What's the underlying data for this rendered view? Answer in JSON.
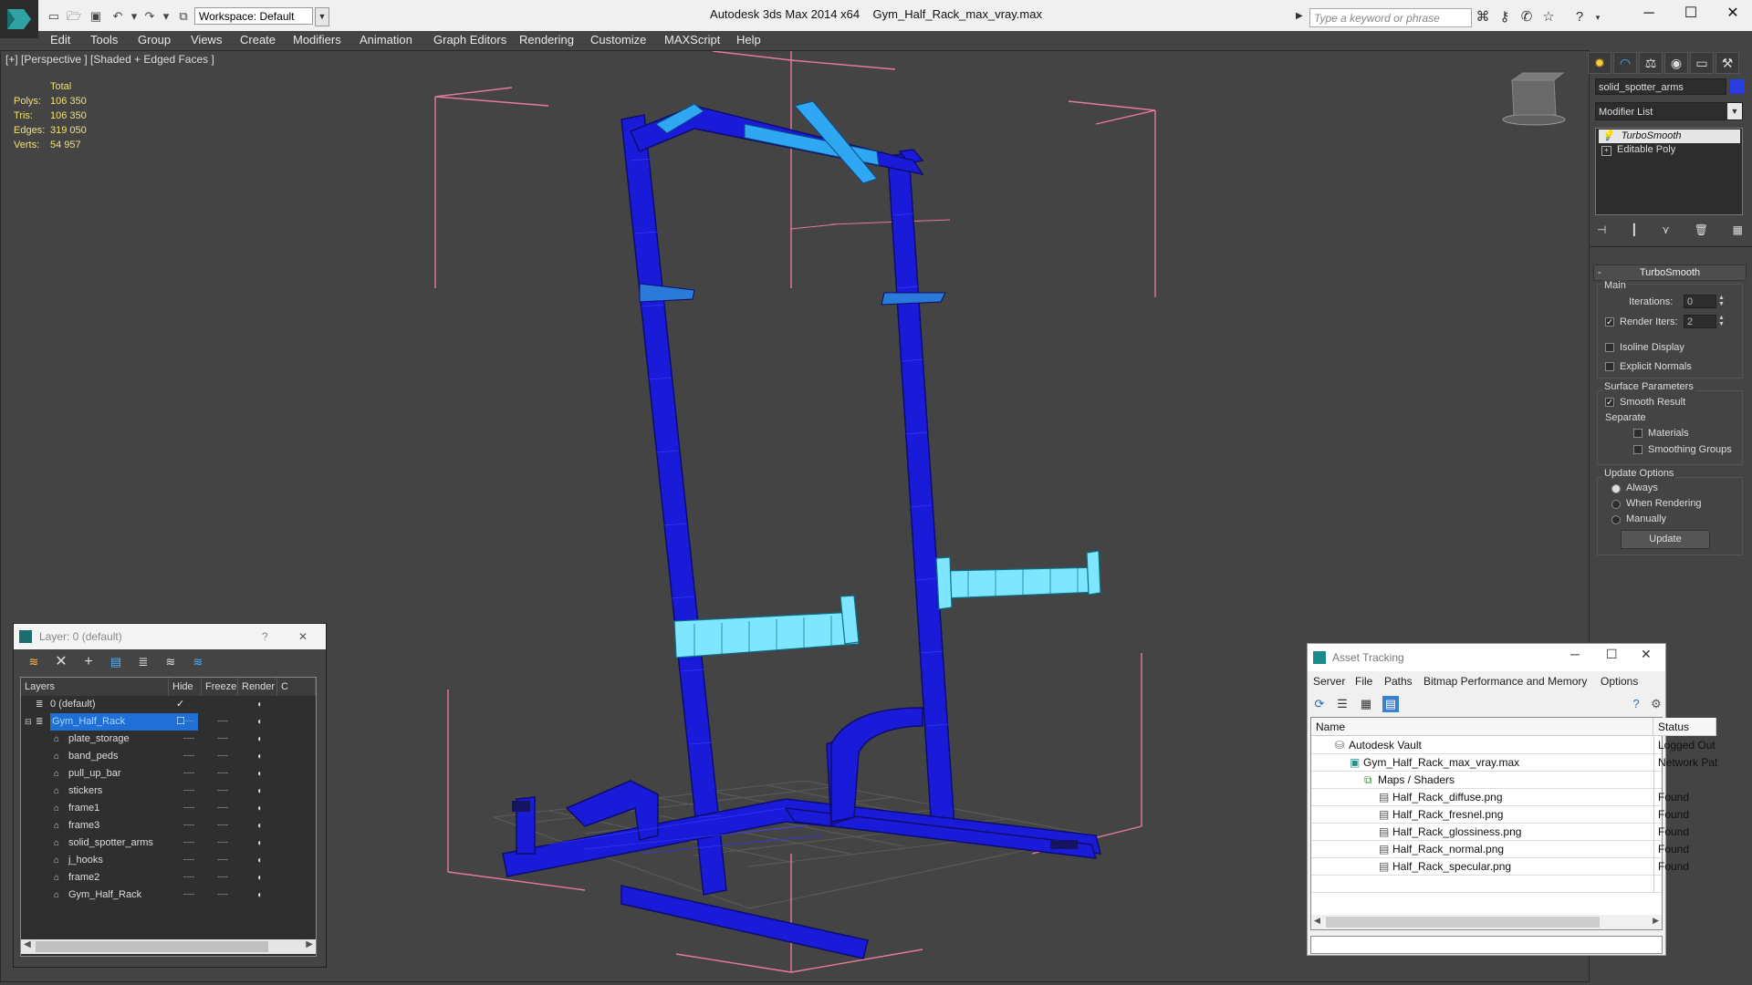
{
  "titlebar": {
    "workspace": "Workspace: Default",
    "app_title": "Autodesk 3ds Max  2014 x64",
    "file_name": "Gym_Half_Rack_max_vray.max",
    "search_placeholder": "Type a keyword or phrase"
  },
  "menu": [
    "Edit",
    "Tools",
    "Group",
    "Views",
    "Create",
    "Modifiers",
    "Animation",
    "Graph Editors",
    "Rendering",
    "Customize",
    "MAXScript",
    "Help"
  ],
  "viewport": {
    "label": "[+] [Perspective ] [Shaded + Edged Faces ]",
    "stats_header": "Total",
    "stats": [
      {
        "label": "Polys:",
        "value": "106 350"
      },
      {
        "label": "Tris:",
        "value": "106 350"
      },
      {
        "label": "Edges:",
        "value": "319 050"
      },
      {
        "label": "Verts:",
        "value": "54 957"
      }
    ],
    "wire_color": "#1a1ad9",
    "selected_color": "#5fd7ff",
    "bbox_color": "#e87a9a"
  },
  "command_panel": {
    "object_name": "solid_spotter_arms",
    "object_color": "#2a3bdf",
    "modifier_list": "Modifier List",
    "stack": [
      "TurboSmooth",
      "Editable Poly"
    ],
    "rollout_title": "TurboSmooth",
    "main_label": "Main",
    "iterations_label": "Iterations:",
    "iterations_value": "0",
    "render_iters_label": "Render Iters:",
    "render_iters_value": "2",
    "isoline_label": "Isoline Display",
    "explicit_label": "Explicit Normals",
    "surface_label": "Surface Parameters",
    "smooth_result_label": "Smooth Result",
    "separate_label": "Separate",
    "materials_label": "Materials",
    "smoothing_groups_label": "Smoothing Groups",
    "update_options_label": "Update Options",
    "always_label": "Always",
    "when_rendering_label": "When Rendering",
    "manually_label": "Manually",
    "update_button": "Update"
  },
  "layer_panel": {
    "title": "Layer: 0 (default)",
    "help": "?",
    "close": "✕",
    "columns": [
      "Layers",
      "Hide",
      "Freeze",
      "Render",
      "C"
    ],
    "layers": [
      {
        "name": "0 (default)",
        "level": 0
      },
      {
        "name": "Gym_Half_Rack",
        "level": 0
      },
      {
        "name": "plate_storage",
        "level": 1
      },
      {
        "name": "band_peds",
        "level": 1
      },
      {
        "name": "pull_up_bar",
        "level": 1
      },
      {
        "name": "stickers",
        "level": 1
      },
      {
        "name": "frame1",
        "level": 1
      },
      {
        "name": "frame3",
        "level": 1
      },
      {
        "name": "solid_spotter_arms",
        "level": 1
      },
      {
        "name": "j_hooks",
        "level": 1
      },
      {
        "name": "frame2",
        "level": 1
      },
      {
        "name": "Gym_Half_Rack",
        "level": 1
      }
    ]
  },
  "asset_tracking": {
    "title": "Asset Tracking",
    "menu": [
      "Server",
      "File",
      "Paths",
      "Bitmap Performance and Memory",
      "Options"
    ],
    "columns": [
      "Name",
      "Status"
    ],
    "rows": [
      {
        "name": "Autodesk Vault",
        "status": "Logged Out",
        "level": 0
      },
      {
        "name": "Gym_Half_Rack_max_vray.max",
        "status": "Network Pat",
        "level": 1
      },
      {
        "name": "Maps / Shaders",
        "status": "",
        "level": 2
      },
      {
        "name": "Half_Rack_diffuse.png",
        "status": "Found",
        "level": 3
      },
      {
        "name": "Half_Rack_fresnel.png",
        "status": "Found",
        "level": 3
      },
      {
        "name": "Half_Rack_glossiness.png",
        "status": "Found",
        "level": 3
      },
      {
        "name": "Half_Rack_normal.png",
        "status": "Found",
        "level": 3
      },
      {
        "name": "Half_Rack_specular.png",
        "status": "Found",
        "level": 3
      }
    ]
  }
}
